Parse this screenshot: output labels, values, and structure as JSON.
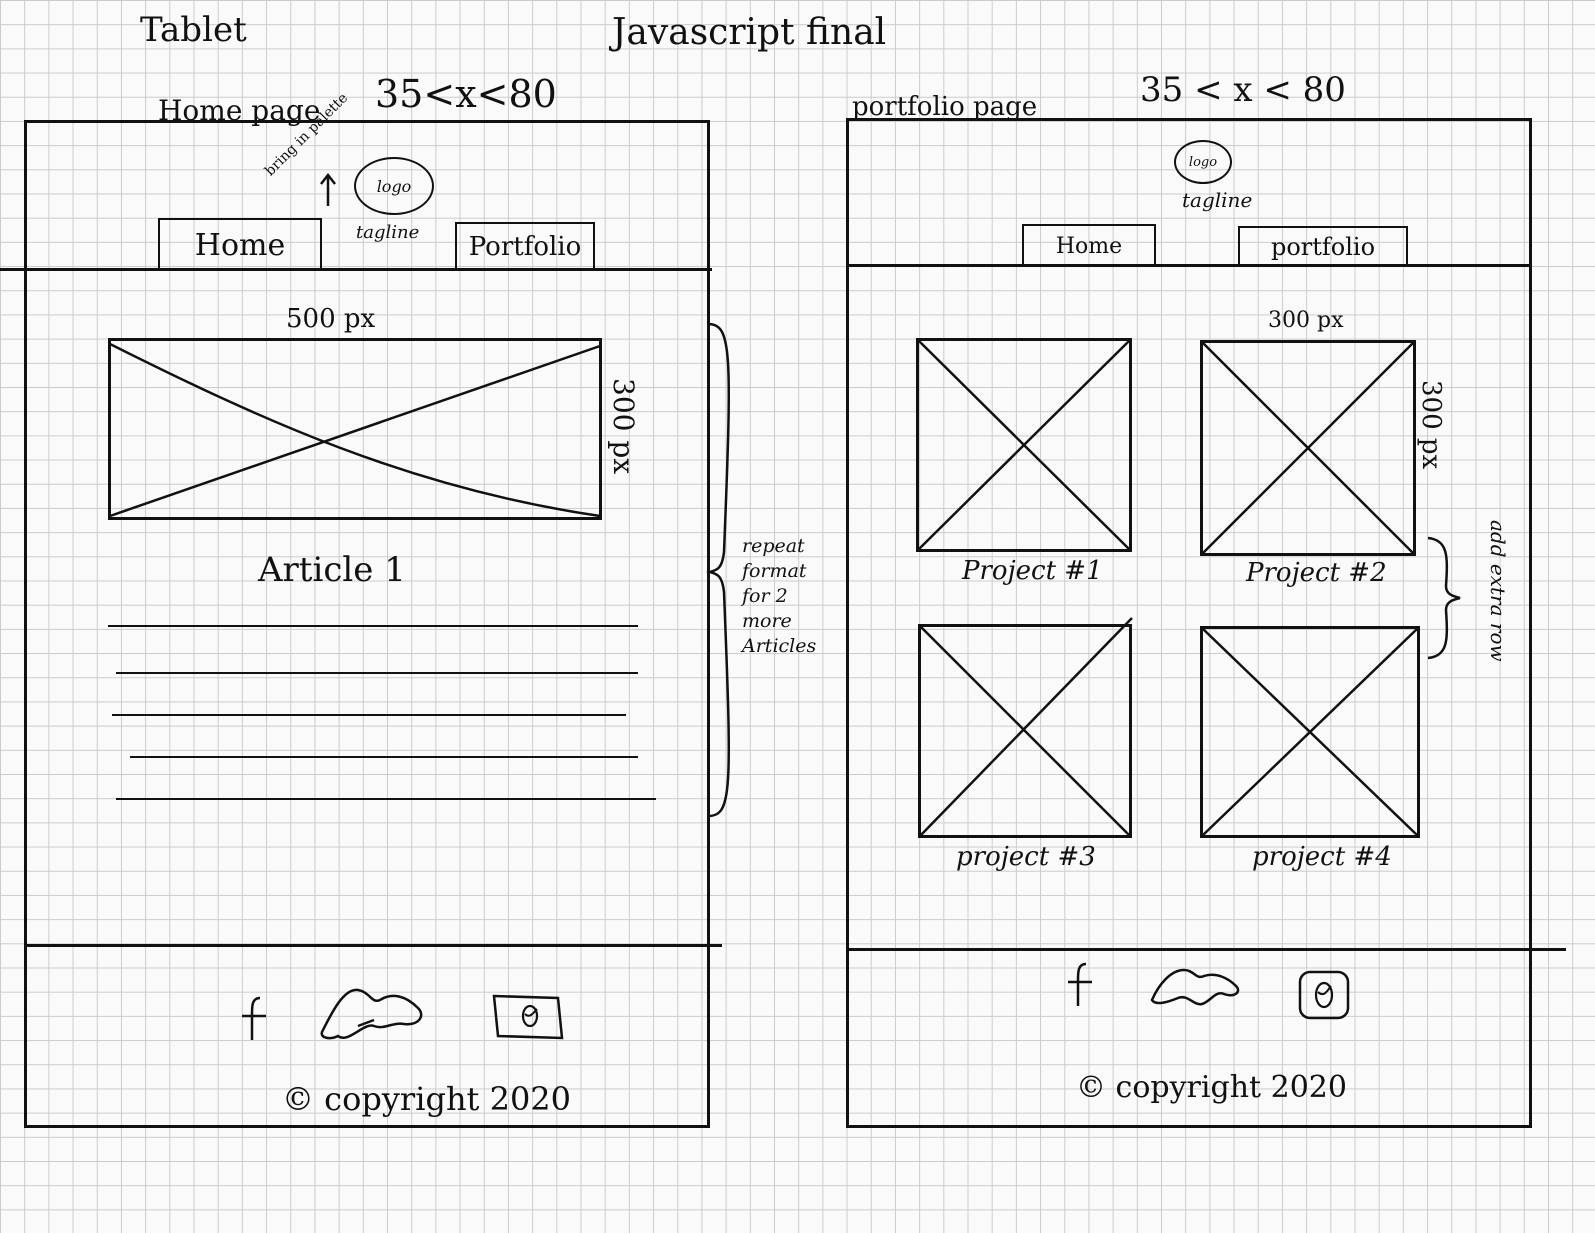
{
  "sheet": {
    "device": "Tablet",
    "title": "Javascript final"
  },
  "home_page": {
    "label": "Home page",
    "breakpoint": "35<x<80",
    "annotation_arrow": "bring in palette",
    "logo": "logo",
    "tagline": "tagline",
    "nav": [
      "Home",
      "Portfolio"
    ],
    "image_width": "500 px",
    "image_height": "300 px",
    "article_title": "Article 1",
    "article_line_count": 5,
    "repeat_note": "repeat format for 2 more Articles",
    "footer_icons": [
      "facebook-icon",
      "cloud-icon",
      "instagram-icon"
    ],
    "copyright": "© copyright 2020"
  },
  "portfolio_page": {
    "label": "portfolio page",
    "breakpoint": "35 < x < 80",
    "logo": "logo",
    "tagline": "tagline",
    "nav": [
      "Home",
      "portfolio"
    ],
    "image_width": "300 px",
    "image_height": "300 px",
    "projects": [
      "Project #1",
      "Project #2",
      "project #3",
      "project #4"
    ],
    "add_row_note": "add extra row",
    "footer_icons": [
      "facebook-icon",
      "cloud-icon",
      "instagram-icon"
    ],
    "copyright": "© copyright 2020"
  }
}
